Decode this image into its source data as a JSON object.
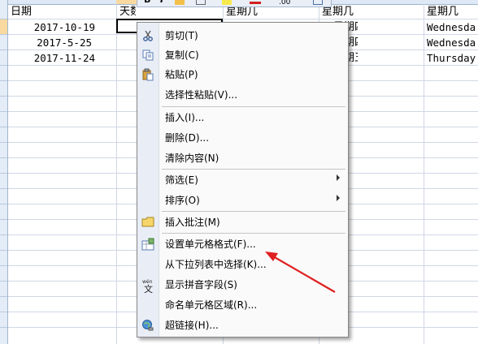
{
  "sheet": {
    "header_row": {
      "col_a": "日期",
      "col_b": "天数",
      "col_c": "星期几",
      "col_d": "星期几",
      "col_e": "星期几"
    },
    "rows": [
      {
        "date": "2017-10-19",
        "d_partial": "星期四",
        "e_partial": "Wednesda"
      },
      {
        "date": "2017-5-25",
        "d_partial": "星期四",
        "e_partial": "Wednesda"
      },
      {
        "date": "2017-11-24",
        "d_partial": "星期五",
        "e_partial": "Thursday"
      }
    ]
  },
  "minitoolbar": {
    "bold": "B",
    "italic": "I",
    "decimals": ".00"
  },
  "context_menu": {
    "items": [
      {
        "id": "cut",
        "label": "剪切(T)",
        "icon": "scissors-icon"
      },
      {
        "id": "copy",
        "label": "复制(C)",
        "icon": "copy-icon"
      },
      {
        "id": "paste",
        "label": "粘贴(P)",
        "icon": "paste-icon"
      },
      {
        "id": "paste-special",
        "label": "选择性粘贴(V)...",
        "icon": ""
      },
      {
        "id": "insert",
        "label": "插入(I)...",
        "icon": ""
      },
      {
        "id": "delete",
        "label": "删除(D)...",
        "icon": ""
      },
      {
        "id": "clear",
        "label": "清除内容(N)",
        "icon": ""
      },
      {
        "id": "filter",
        "label": "筛选(E)",
        "icon": "",
        "submenu": true
      },
      {
        "id": "sort",
        "label": "排序(O)",
        "icon": "",
        "submenu": true
      },
      {
        "id": "comment",
        "label": "插入批注(M)",
        "icon": "comment-icon"
      },
      {
        "id": "format-cells",
        "label": "设置单元格格式(F)...",
        "icon": "format-cells-icon"
      },
      {
        "id": "pick-list",
        "label": "从下拉列表中选择(K)...",
        "icon": ""
      },
      {
        "id": "phonetic",
        "label": "显示拼音字段(S)",
        "icon": "phonetic-icon",
        "icon_text": "wén 文"
      },
      {
        "id": "name-range",
        "label": "命名单元格区域(R)...",
        "icon": ""
      },
      {
        "id": "hyperlink",
        "label": "超链接(H)...",
        "icon": "hyperlink-icon"
      }
    ]
  },
  "colors": {
    "annotation_arrow": "#e02020",
    "selected_header": "#f9d99f",
    "menu_gutter": "#e9eef6"
  }
}
